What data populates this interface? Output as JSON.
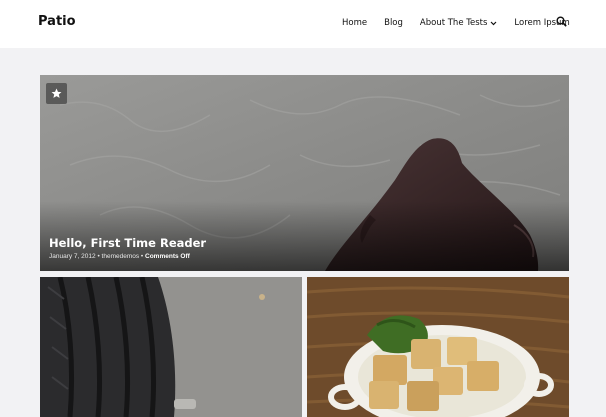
{
  "site": {
    "title": "Patio"
  },
  "nav": {
    "items": [
      {
        "label": "Home"
      },
      {
        "label": "Blog"
      },
      {
        "label": "About The Tests"
      },
      {
        "label": "Lorem Ipsum"
      }
    ]
  },
  "icons": {
    "search": "search-icon",
    "dropdown": "chevron-down-icon",
    "sticky": "star-icon"
  },
  "featured_post": {
    "title": "Hello, First Time Reader",
    "date": "January 7, 2012",
    "separator": "•",
    "author": "themedemos",
    "comments": "Comments Off"
  },
  "colors": {
    "page_background": "#f2f2f4",
    "header_background": "#ffffff",
    "text": "#111111"
  }
}
